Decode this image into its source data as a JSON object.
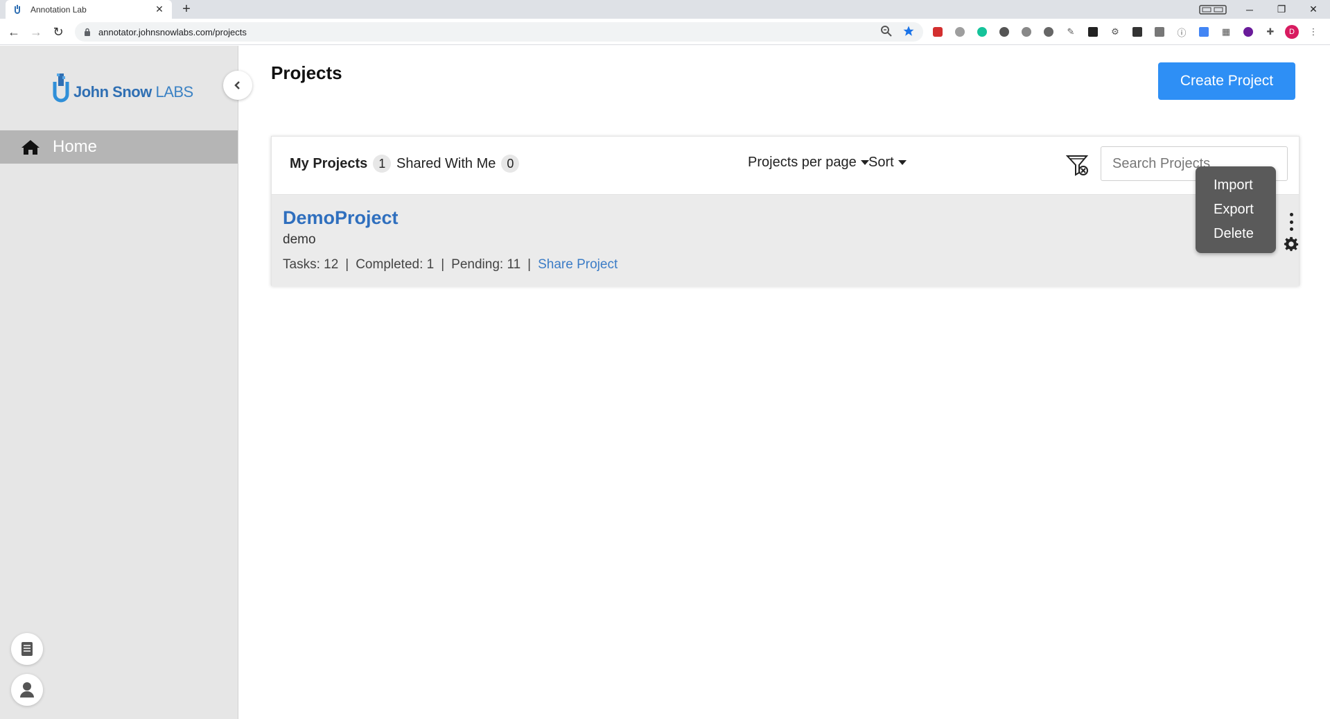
{
  "browser": {
    "tab_title": "Annotation Lab",
    "url": "annotator.johnsnowlabs.com/projects",
    "profile_initial": "D"
  },
  "sidebar": {
    "brand_name": "John Snow",
    "brand_suffix": "LABS",
    "nav_home_label": "Home"
  },
  "page": {
    "title": "Projects",
    "create_button": "Create Project"
  },
  "tabs": [
    {
      "label": "My Projects",
      "count": "1"
    },
    {
      "label": "Shared With Me",
      "count": "0"
    }
  ],
  "toolbar": {
    "per_page_label": "Projects per page",
    "sort_label": "Sort",
    "search_placeholder": "Search Projects"
  },
  "project": {
    "name": "DemoProject",
    "description": "demo",
    "tasks": "Tasks: 12",
    "completed": "Completed: 1",
    "pending": "Pending: 11",
    "share_label": "Share Project"
  },
  "context_menu": {
    "items": [
      "Import",
      "Export",
      "Delete"
    ]
  }
}
